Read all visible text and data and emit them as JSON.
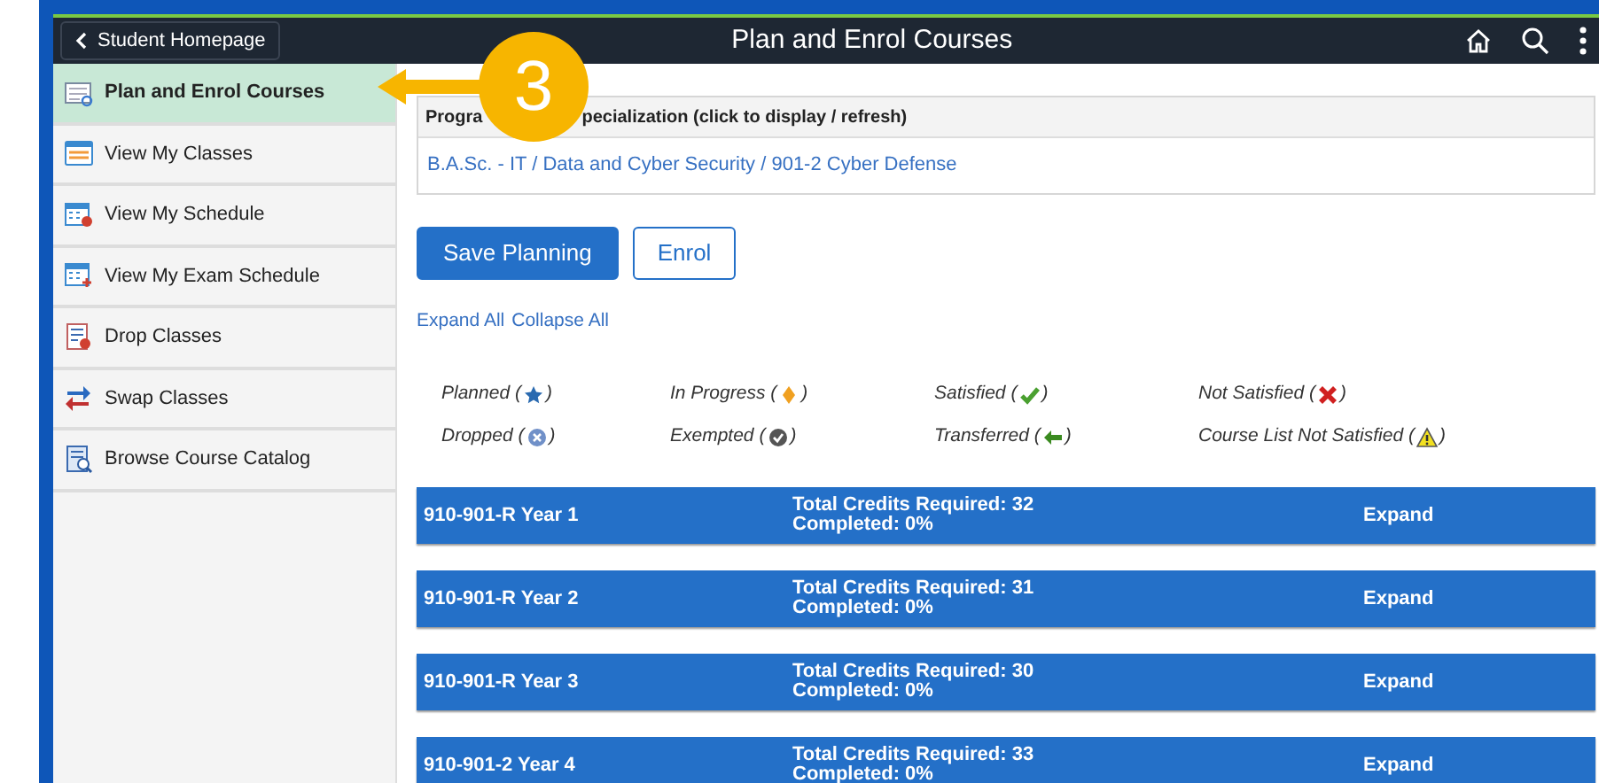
{
  "navbar": {
    "back_label": "Student Homepage",
    "title": "Plan and Enrol Courses"
  },
  "sidebar": {
    "items": [
      {
        "label": "Plan and Enrol Courses",
        "selected": true
      },
      {
        "label": "View My Classes",
        "selected": false
      },
      {
        "label": "View My Schedule",
        "selected": false
      },
      {
        "label": "View My Exam Schedule",
        "selected": false
      },
      {
        "label": "Drop Classes",
        "selected": false
      },
      {
        "label": "Swap Classes",
        "selected": false
      },
      {
        "label": "Browse Course Catalog",
        "selected": false
      }
    ]
  },
  "callout": {
    "label": "3"
  },
  "program_table": {
    "header_parts": [
      "Progra",
      "pecialization (click to display / refresh)"
    ],
    "link": "B.A.Sc. - IT / Data and Cyber Security / 901-2 Cyber Defense"
  },
  "buttons": [
    {
      "label": "Save Planning",
      "kind": "primary"
    },
    {
      "label": "Enrol",
      "kind": "outline"
    }
  ],
  "links": [
    "Expand All",
    "Collapse All"
  ],
  "legend": [
    {
      "label": "Planned (",
      "close": ")",
      "kind": "planned"
    },
    {
      "label": "In Progress (",
      "close": ")",
      "kind": "in_progress"
    },
    {
      "label": "Satisfied (",
      "close": ")",
      "kind": "satisfied"
    },
    {
      "label": "Not Satisfied (",
      "close": ")",
      "kind": "not_satisfied"
    },
    {
      "label": "Dropped (",
      "close": ")",
      "kind": "dropped"
    },
    {
      "label": "Exempted (",
      "close": ")",
      "kind": "exempted"
    },
    {
      "label": "Transferred (",
      "close": ")",
      "kind": "transferred"
    },
    {
      "label": "Course List Not Satisfied (",
      "close": ")",
      "kind": "list_not_satisfied"
    }
  ],
  "years": [
    {
      "name": "910-901-R Year 1",
      "credits": "Total Credits Required: 32",
      "completed": "Completed: 0%",
      "action": "Expand"
    },
    {
      "name": "910-901-R Year 2",
      "credits": "Total Credits Required: 31",
      "completed": "Completed: 0%",
      "action": "Expand"
    },
    {
      "name": "910-901-R Year 3",
      "credits": "Total Credits Required: 30",
      "completed": "Completed: 0%",
      "action": "Expand"
    },
    {
      "name": "910-901-2 Year 4",
      "credits": "Total Credits Required: 33",
      "completed": "Completed: 0%",
      "action": "Expand"
    }
  ]
}
